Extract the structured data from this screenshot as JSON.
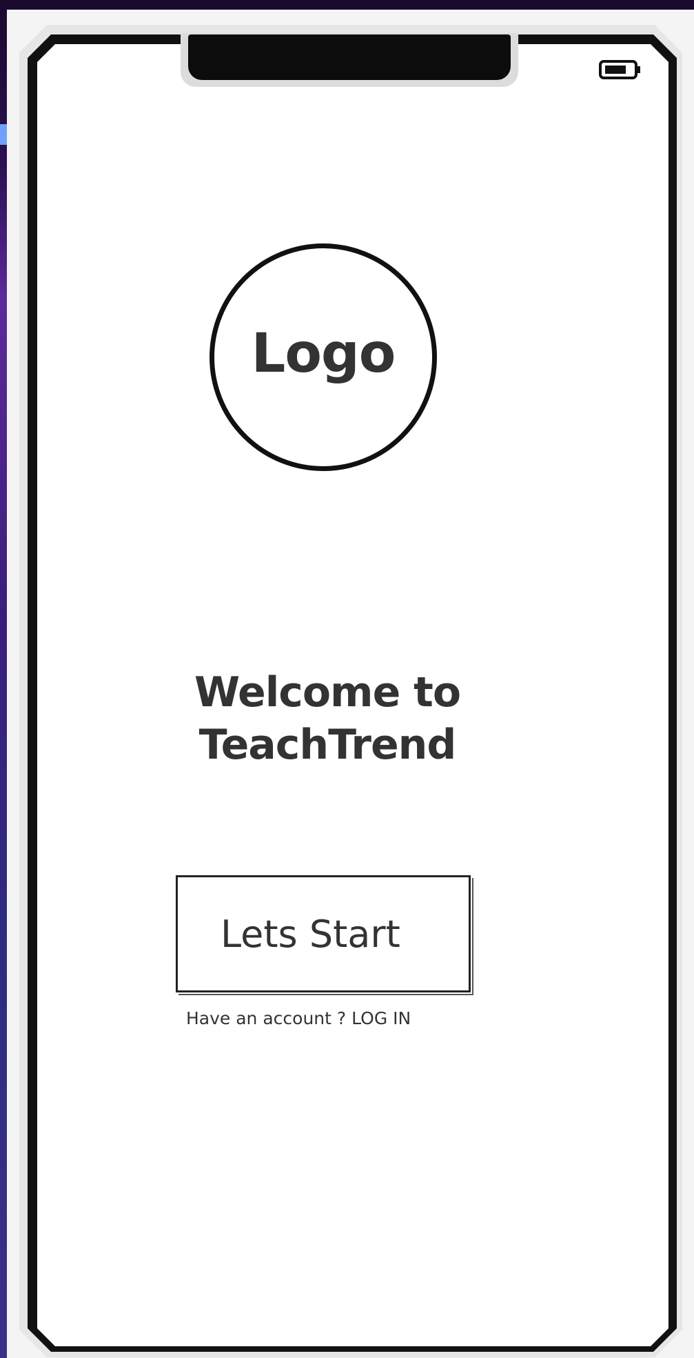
{
  "logo": {
    "text": "Logo"
  },
  "welcome": {
    "line1": "Welcome to",
    "line2": "TeachTrend"
  },
  "start_button": {
    "label": "Lets Start"
  },
  "login_prompt": {
    "text": "Have an account ? LOG IN"
  },
  "status_bar": {
    "battery_icon": "battery-icon"
  },
  "colors": {
    "background": "#ffffff",
    "stroke": "#111111",
    "text": "#333333",
    "backdrop": "#2a1050"
  }
}
